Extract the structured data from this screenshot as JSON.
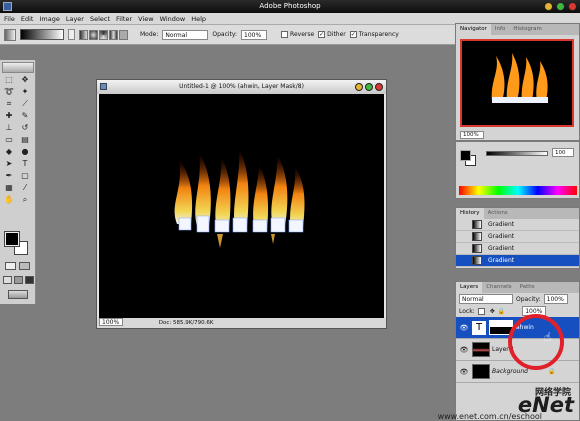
{
  "app": {
    "title": "Adobe Photoshop"
  },
  "menu": [
    "File",
    "Edit",
    "Image",
    "Layer",
    "Select",
    "Filter",
    "View",
    "Window",
    "Help"
  ],
  "options": {
    "mode_label": "Mode:",
    "mode_value": "Normal",
    "opacity_label": "Opacity:",
    "opacity_value": "100%",
    "reverse_label": "Reverse",
    "dither_label": "Dither",
    "transparency_label": "Transparency"
  },
  "document": {
    "title": "Untitled-1 @ 100% (ahwin, Layer Mask/8)",
    "zoom": "100%",
    "doc_info": "Doc: 585.9K/790.6K"
  },
  "navigator": {
    "tabs": [
      "Navigator",
      "Info",
      "Histogram"
    ],
    "zoom": "100%"
  },
  "color": {
    "value": "100"
  },
  "history": {
    "tabs": [
      "History",
      "Actions"
    ],
    "items": [
      "Gradient",
      "Gradient",
      "Gradient",
      "Gradient"
    ]
  },
  "layers": {
    "tabs": [
      "Layers",
      "Channels",
      "Paths"
    ],
    "blend_mode": "Normal",
    "opacity_label": "Opacity:",
    "opacity_value": "100%",
    "lock_label": "Lock:",
    "fill_value": "100%",
    "items": [
      {
        "name": "ahwin",
        "selected": true
      },
      {
        "name": "Layer 1",
        "selected": false
      },
      {
        "name": "Background",
        "selected": false
      }
    ]
  },
  "watermark": {
    "logo": "eNet",
    "cn": "网络学院",
    "url": "www.enet.com.cn/eschool"
  },
  "colors": {
    "selection": "#1650c0",
    "highlight_circle": "#e0212b",
    "flame_orange": "#ff8a12",
    "flame_yellow": "#ffe25a"
  }
}
